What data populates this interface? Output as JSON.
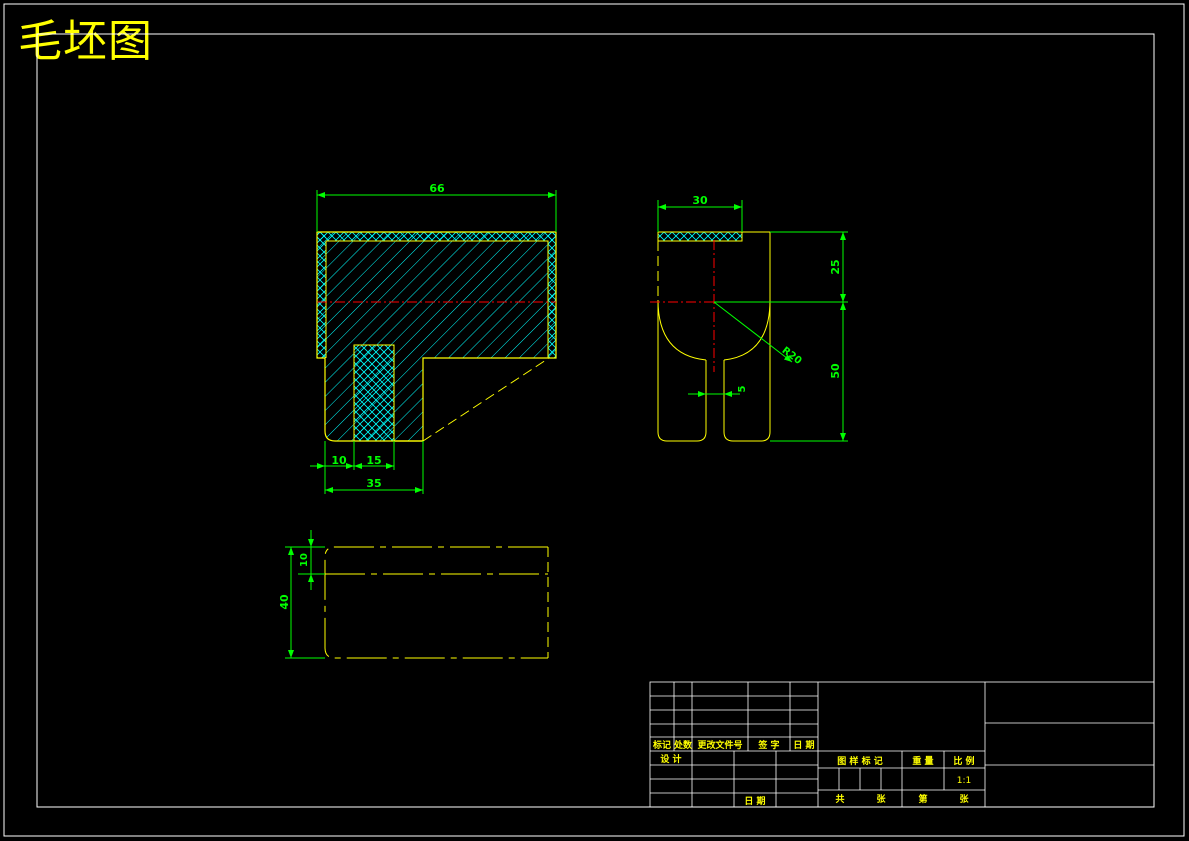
{
  "drawing": {
    "title": "毛坯图",
    "colors": {
      "background": "#000000",
      "border": "#ffffff",
      "outline": "#ffff00",
      "dimension": "#00ff00",
      "hatch": "#00ffff",
      "centerline": "#ff0000",
      "title_text": "#ffff00"
    }
  },
  "front_view": {
    "dims": {
      "top_width": "66",
      "left_offset": "10",
      "insert_width": "15",
      "bottom_width": "35"
    }
  },
  "side_view": {
    "dims": {
      "top_width": "30",
      "upper_height": "25",
      "lower_height": "50",
      "radius": "R20",
      "slot": "5"
    }
  },
  "top_view": {
    "dims": {
      "height": "40",
      "thin": "10"
    }
  },
  "title_block": {
    "rev_headers": [
      "标记",
      "处数",
      "更改文件号",
      "签 字",
      "日 期"
    ],
    "design": "设 计",
    "date": "日 期",
    "stage_header": [
      "图 样 标 记",
      "重 量",
      "比 例"
    ],
    "scale": "1:1",
    "sheets": [
      "共",
      "张",
      "第",
      "张"
    ]
  }
}
